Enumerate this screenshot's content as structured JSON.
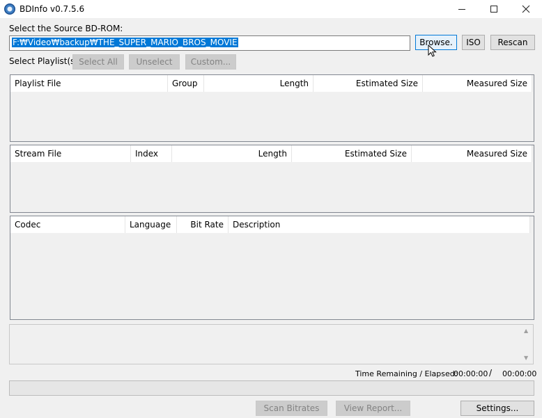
{
  "window": {
    "title": "BDInfo v0.7.5.6",
    "minimize_icon": "minimize-icon",
    "maximize_icon": "maximize-icon",
    "close_icon": "close-icon"
  },
  "source": {
    "label": "Select the Source BD-ROM:",
    "path_value": "F:₩Video₩backup₩THE_SUPER_MARIO_BROS_MOVIE",
    "browse_label": "Browse.",
    "iso_label": "ISO",
    "rescan_label": "Rescan"
  },
  "playlist_select": {
    "label": "Select Playlist(s",
    "select_all_label": "Select All",
    "unselect_label": "Unselect",
    "custom_label": "Custom..."
  },
  "playlist_table": {
    "columns": [
      "Playlist File",
      "Group",
      "Length",
      "Estimated Size",
      "Measured Size"
    ]
  },
  "stream_table": {
    "columns": [
      "Stream File",
      "Index",
      "Length",
      "Estimated Size",
      "Measured Size"
    ]
  },
  "codec_table": {
    "columns": [
      "Codec",
      "Language",
      "Bit Rate",
      "Description"
    ]
  },
  "status": {
    "time_label": "Time Remaining / Elapsed:",
    "remaining": "00:00:00",
    "separator": "/",
    "elapsed": "00:00:00"
  },
  "footer": {
    "scan_bitrates_label": "Scan Bitrates",
    "view_report_label": "View Report...",
    "settings_label": "Settings..."
  },
  "colors": {
    "accent": "#0078d7",
    "window_bg": "#f0f0f0"
  }
}
